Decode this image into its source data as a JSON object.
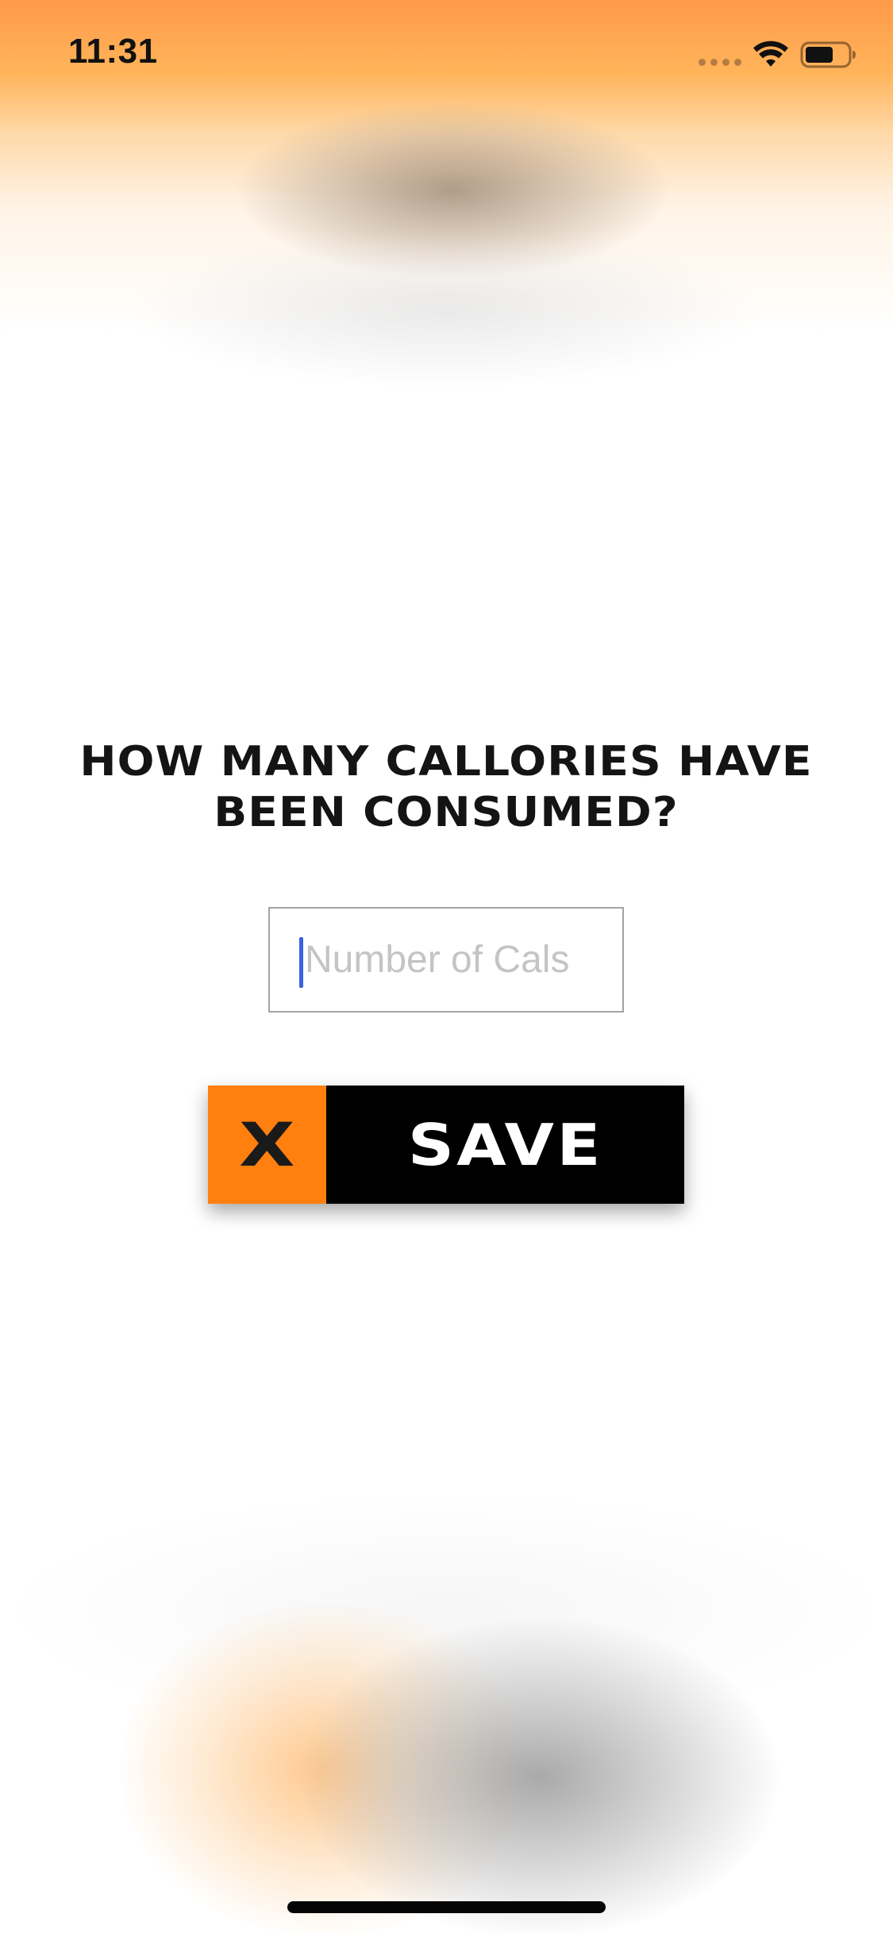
{
  "status_bar": {
    "time": "11:31",
    "icons": [
      "signal-dots-icon",
      "wifi-icon",
      "battery-icon"
    ]
  },
  "prompt": {
    "question": "HOW MANY CALLORIES HAVE BEEN CONSUMED?"
  },
  "calorie_input": {
    "value": "",
    "placeholder": "Number of Cals"
  },
  "actions": {
    "cancel_label": "X",
    "save_label": "SAVE"
  },
  "colors": {
    "accent_orange": "#ff7f0f",
    "save_background": "#000000",
    "caret": "#3a62e0",
    "input_border": "#a4a4a4"
  }
}
